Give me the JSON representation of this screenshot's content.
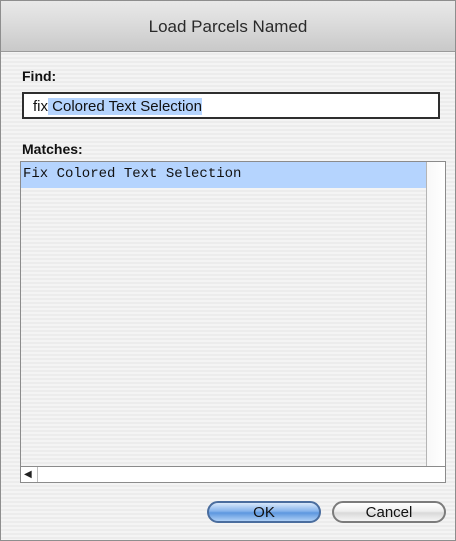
{
  "window": {
    "title": "Load Parcels Named"
  },
  "find": {
    "label": "Find:",
    "typed_text": "fix",
    "selected_text": " Colored Text Selection"
  },
  "matches": {
    "label": "Matches:",
    "items": [
      "Fix Colored Text Selection"
    ],
    "selected_index": 0
  },
  "buttons": {
    "ok_label": "OK",
    "cancel_label": "Cancel"
  },
  "icons": {
    "hscroll_left": "scroll-left-arrow-icon"
  },
  "colors": {
    "selection": "#b5d4fe",
    "default_button": "#6fa3e6"
  }
}
